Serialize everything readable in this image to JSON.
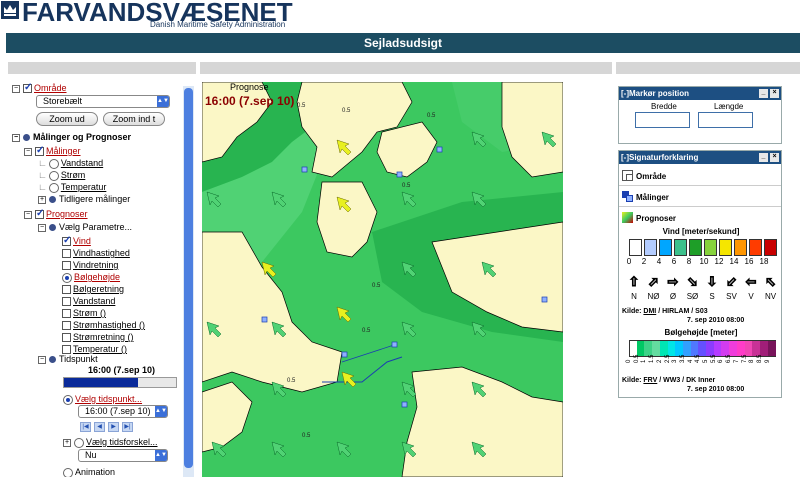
{
  "header": {
    "logo_text": "FARVANDSVÆSENET",
    "logo_subtitle": "Danish Maritime Safety Administration",
    "page_title": "Sejladsudsigt"
  },
  "left": {
    "area": {
      "label": "Område",
      "select_value": "Storebælt",
      "zoom_out": "Zoom ud",
      "zoom_in": "Zoom ind t"
    },
    "measurements_forecasts_label": "Målinger og Prognoser",
    "measurements": {
      "label": "Målinger",
      "items": [
        "Vandstand",
        "Strøm",
        "Temperatur"
      ],
      "previous": "Tidligere målinger"
    },
    "forecasts": {
      "label": "Prognoser",
      "choose_params": "Vælg Parametre...",
      "params": [
        "Vind",
        "Vindhastighed",
        "Vindretning",
        "Bølgehøjde",
        "Bølgeretning",
        "Vandstand",
        "Strøm ()",
        "Strømhastighed ()",
        "Strømretning ()",
        "Temperatur ()"
      ]
    },
    "time": {
      "label": "Tidspunkt",
      "current": "16:00 (7.sep 10)",
      "progress_fraction": 0.66,
      "choose_time": "Vælg tidspunkt...",
      "time_select": "16:00 (7.sep 10)",
      "choose_offset": "Vælg tidsforskel...",
      "offset_select": "Nu",
      "animation": "Animation"
    }
  },
  "map": {
    "prognose_label": "Prognose",
    "prognose_time": "16:00 (7.sep 10)",
    "contour_labels": [
      "0.5",
      "0.5",
      "0.5",
      "0.5",
      "0.5",
      "0.5",
      "0.5",
      "0.5"
    ]
  },
  "right": {
    "marker": {
      "title": "[-]Markør position",
      "bredde": "Bredde",
      "laengde": "Længde"
    },
    "legend": {
      "title": "[-]Signaturforklaring",
      "omraade": "Område",
      "maalinger": "Målinger",
      "prognoser": "Prognoser",
      "wind_title": "Vind [meter/sekund]",
      "wind_ticks": [
        "0",
        "2",
        "4",
        "6",
        "8",
        "10",
        "12",
        "14",
        "16",
        "18"
      ],
      "wind_colors": [
        "#ffffff",
        "#b3ccff",
        "#00a6ff",
        "#3cc08c",
        "#1e9e28",
        "#86d23c",
        "#f5e600",
        "#ff9600",
        "#ff3c00",
        "#c80000"
      ],
      "directions": [
        "N",
        "NØ",
        "Ø",
        "SØ",
        "S",
        "SV",
        "V",
        "NV"
      ],
      "wind_source_prefix": "Kilde:",
      "wind_source_link": "DMI",
      "wind_source_rest": "/ HIRLAM / S03",
      "wind_source_date": "7. sep 2010 08:00",
      "wave_title": "Bølgehøjde [meter]",
      "wave_ticks": [
        "0",
        "0.5",
        "1",
        "1.5",
        "2",
        "2.5",
        "3",
        "3.5",
        "4",
        "4.5",
        "5",
        "5.5",
        "6",
        "6.5",
        "7",
        "7.5",
        "8",
        "8.5",
        "9"
      ],
      "wave_colors": [
        "#ffffff",
        "#00c864",
        "#3cd287",
        "#64dca0",
        "#00e6b4",
        "#00e6e6",
        "#00c8ff",
        "#32a0ff",
        "#5078ff",
        "#6450ff",
        "#8c3cff",
        "#b43cff",
        "#d23cf0",
        "#f03cdc",
        "#ff3cc8",
        "#f046b4",
        "#c83296",
        "#a01e78",
        "#78145a"
      ],
      "wave_source_prefix": "Kilde:",
      "wave_source_link": "FRV",
      "wave_source_rest": "/ WW3 / DK Inner",
      "wave_source_date": "7. sep 2010 08:00"
    }
  }
}
